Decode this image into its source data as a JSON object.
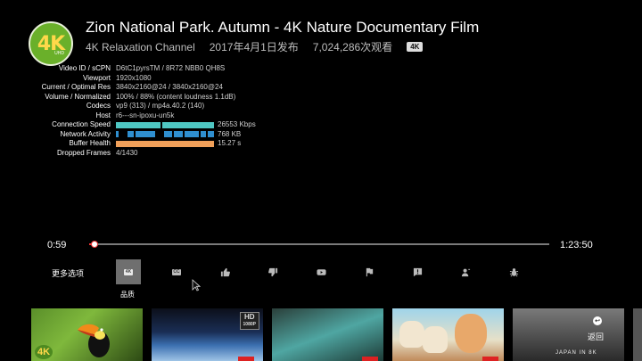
{
  "header": {
    "logo_text": "4K",
    "logo_sub": "UHD",
    "title": "Zion National Park. Autumn - 4K Nature Documentary Film",
    "channel": "4K Relaxation Channel",
    "published": "2017年4月1日发布",
    "views": "7,024,286次观看",
    "badge": "4K"
  },
  "stats": [
    {
      "label": "Video ID / sCPN",
      "value": "D6tC1pyrsTM / 8R72 NBB0 QH8S"
    },
    {
      "label": "Viewport",
      "value": "1920x1080"
    },
    {
      "label": "Current / Optimal Res",
      "value": "3840x2160@24 / 3840x2160@24"
    },
    {
      "label": "Volume / Normalized",
      "value": "100% / 88% (content loudness 1.1dB)"
    },
    {
      "label": "Codecs",
      "value": "vp9 (313) / mp4a.40.2 (140)"
    },
    {
      "label": "Host",
      "value": "r6---sn-ipoxu-un5k"
    },
    {
      "label": "Connection Speed",
      "value": "26553 Kbps"
    },
    {
      "label": "Network Activity",
      "value": "768 KB"
    },
    {
      "label": "Buffer Health",
      "value": "15.27 s"
    },
    {
      "label": "Dropped Frames",
      "value": "4/1430"
    }
  ],
  "player": {
    "current_time": "0:59",
    "total_time": "1:23:50",
    "progress_fraction": 0.012
  },
  "controls": {
    "more_options": "更多选项",
    "quality_label": "品质",
    "quality_icon_text": "4K",
    "cc_icon_text": "CC",
    "items": [
      {
        "name": "quality-icon"
      },
      {
        "name": "captions-icon"
      },
      {
        "name": "thumbs-up-icon"
      },
      {
        "name": "thumbs-down-icon"
      },
      {
        "name": "youtube-icon"
      },
      {
        "name": "flag-icon"
      },
      {
        "name": "info-icon"
      },
      {
        "name": "user-icon"
      },
      {
        "name": "bug-icon"
      }
    ]
  },
  "thumbnails": {
    "t1_logo": "4K",
    "t2_badge": "HD",
    "t2_badge_sub": "1080P",
    "t5_text": "JAPAN IN 8K",
    "back_label": "返回"
  },
  "colors": {
    "progress": "#ee3333",
    "connection_bar": "#4fc7c3",
    "activity_bar": "#2f8fd0",
    "buffer_bar": "#f0a05a"
  }
}
